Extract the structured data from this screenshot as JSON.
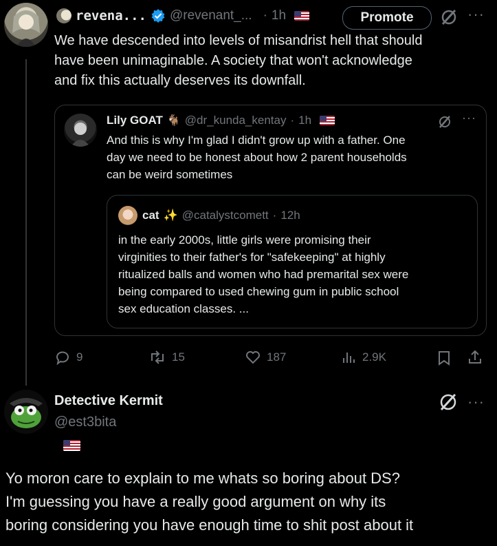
{
  "post": {
    "display_name": "revena...",
    "handle": "@revenant_...",
    "sep": "·",
    "time": "1h",
    "promote_label": "Promote",
    "more": "···",
    "text_lines": [
      "We have descended into levels of misandrist hell that should",
      "have been unimaginable. A society that won't acknowledge",
      "and fix this actually deserves its downfall."
    ]
  },
  "quote": {
    "display_name": "Lily GOAT",
    "name_emoji": "🐐",
    "handle": "@dr_kunda_kentay",
    "sep": "·",
    "time": "1h",
    "more": "···",
    "text_lines": [
      "And this is why I'm glad I didn't grow up with a father. One",
      "day we need to be honest about how 2 parent households",
      "can be weird sometimes"
    ],
    "nested": {
      "display_name": "cat",
      "name_emoji": "✨",
      "handle": "@catalystcomett",
      "sep": "·",
      "time": "12h",
      "text_lines": [
        "in the early 2000s, little girls were promising their",
        "virginities to their father's for \"safekeeping\" at highly",
        "ritualized balls and women who had premarital sex were",
        "being compared to used chewing gum in public school",
        "sex education classes. ..."
      ]
    }
  },
  "actions": {
    "replies": "9",
    "reposts": "15",
    "likes": "187",
    "views": "2.9K"
  },
  "reply": {
    "display_name": "Detective Kermit",
    "handle": "@est3bita",
    "more": "···",
    "text_lines": [
      "Yo moron care to explain to me whats so boring about DS?",
      "I'm guessing you have a really good argument on why its",
      "boring considering you have enough time to shit post about it"
    ]
  },
  "colors": {
    "background": "#000000",
    "text": "#e7e9ea",
    "muted": "#71767b",
    "verified": "#1d9bf0",
    "border": "#2f3336"
  }
}
